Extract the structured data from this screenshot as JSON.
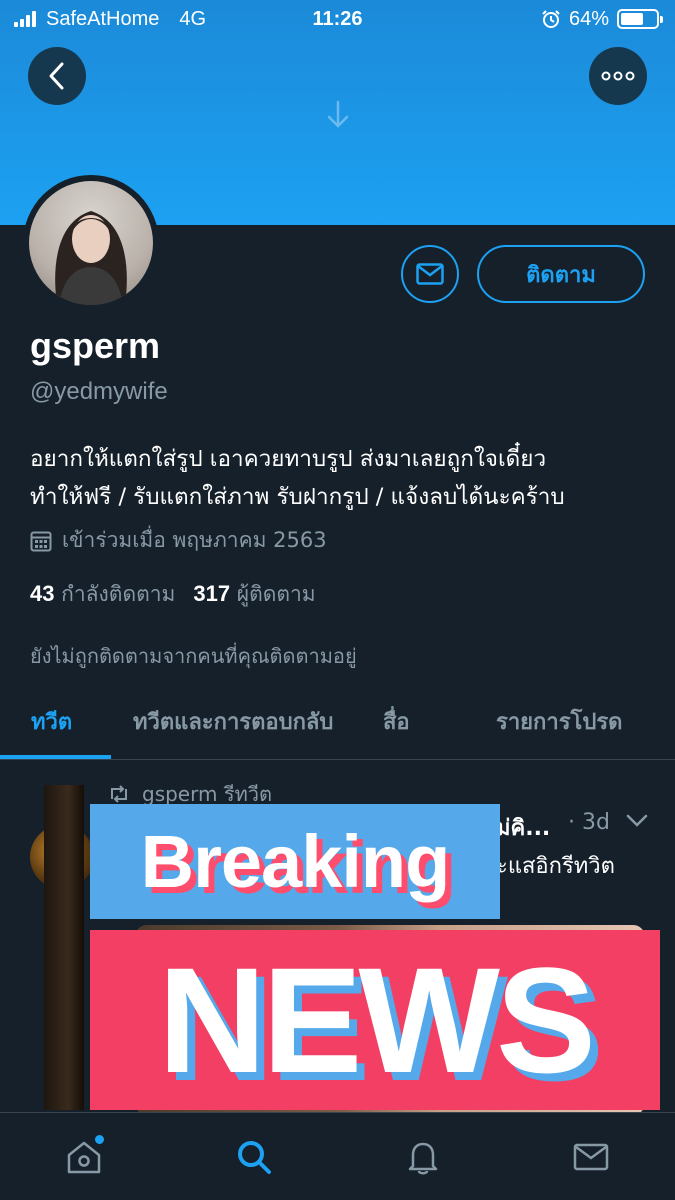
{
  "status_bar": {
    "carrier": "SafeAtHome",
    "network": "4G",
    "time": "11:26",
    "battery": "64%",
    "battery_level": 0.64
  },
  "header": {
    "back_icon": "chevron-left-icon",
    "more_icon": "ellipsis-icon"
  },
  "profile": {
    "display_name": "gsperm",
    "handle": "@yedmywife",
    "bio_line1": "อยากให้แตกใส่รูป เอาควยทาบรูป ส่งมาเลยถูกใจเดี๋ยว",
    "bio_line2": "ทำให้ฟรี / รับแตกใส่ภาพ รับฝากรูป / แจ้งลบได้นะคร้าบ",
    "joined": "เข้าร่วมเมื่อ พฤษภาคม 2563",
    "following_count": "43",
    "following_label": "กำลังติดตาม",
    "followers_count": "317",
    "followers_label": "ผู้ติดตาม",
    "not_followed_note": "ยังไม่ถูกติดตามจากคนที่คุณติดตามอยู่",
    "follow_button": "ติดตาม"
  },
  "tabs": [
    {
      "label": "ทวีต",
      "active": true
    },
    {
      "label": "ทวีตและการตอบกลับ",
      "active": false
    },
    {
      "label": "สื่อ",
      "active": false
    },
    {
      "label": "รายการโปรด",
      "active": false
    }
  ],
  "tweet": {
    "retweet_label": "gsperm รีทวีต",
    "name_visible": "ม่คิ...",
    "time": "· 3d",
    "text_visible": "ะแสอิกรีทวิต"
  },
  "overlay": {
    "top_text": "Breaking",
    "bottom_text": "NEWS"
  },
  "colors": {
    "accent": "#1da1f2",
    "background": "#15202b",
    "muted": "#8899a6",
    "news_red": "#f33f63",
    "news_blue": "#55a9ea"
  },
  "bottom_nav": [
    "home-icon",
    "search-icon",
    "bell-icon",
    "mail-icon"
  ]
}
